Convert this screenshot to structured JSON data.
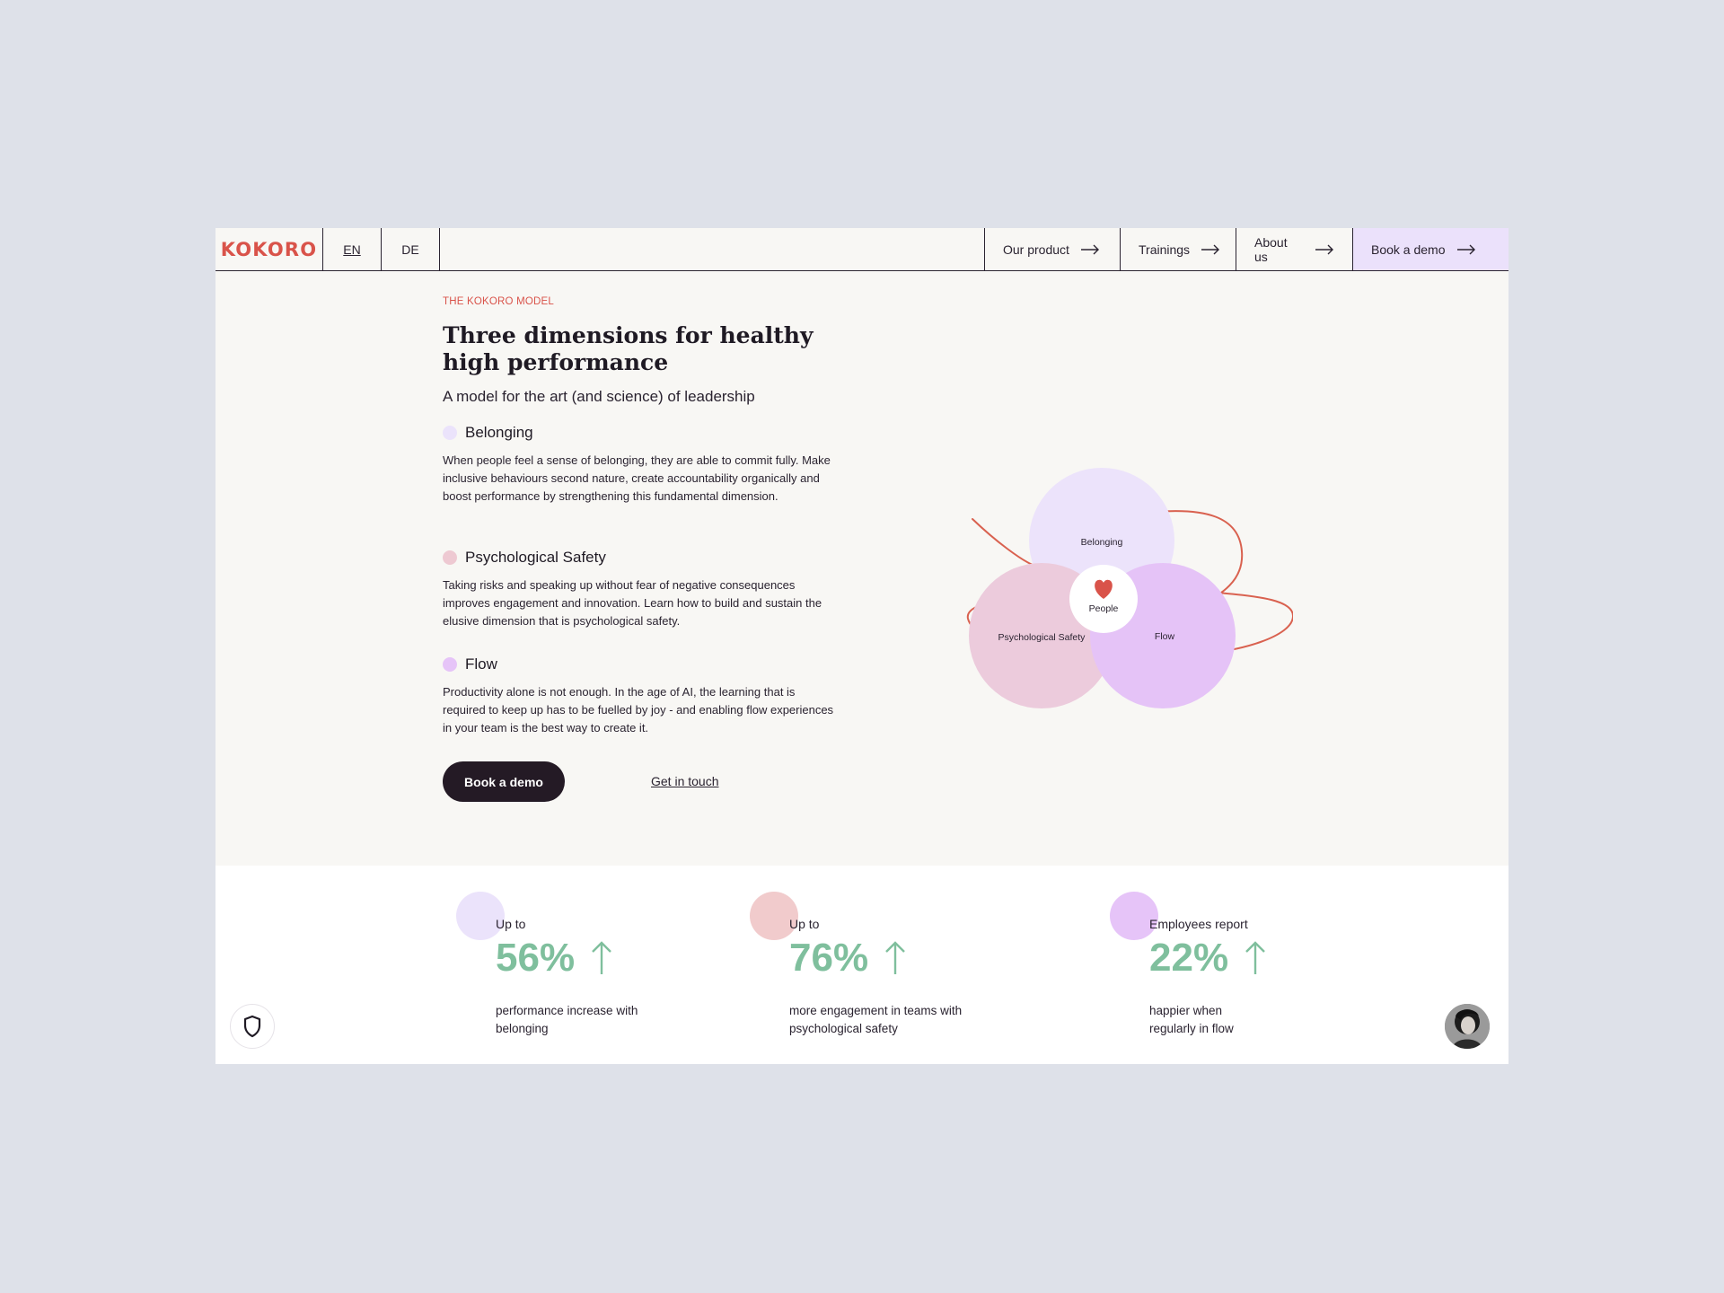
{
  "nav": {
    "logo": "KOKORO",
    "languages": [
      {
        "label": "EN",
        "active": true
      },
      {
        "label": "DE",
        "active": false
      }
    ],
    "links": [
      "Our product",
      "Trainings",
      "About us",
      "Book a demo"
    ]
  },
  "hero": {
    "eyebrow": "THE KOKORO MODEL",
    "title": "Three dimensions for healthy high performance",
    "subtitle": "A model for the art (and science) of leadership",
    "dimensions": [
      {
        "name": "Belonging",
        "color": "#ebe3fb",
        "text": "When people feel a sense of belonging, they are able to commit fully. Make inclusive behaviours second nature, create accountability organically and boost performance by strengthening this fundamental dimension."
      },
      {
        "name": "Psychological Safety",
        "color": "#eec9d2",
        "text": "Taking risks and speaking up without fear of negative consequences improves engagement and innovation. Learn how to build and sustain the elusive dimension that is psychological safety."
      },
      {
        "name": "Flow",
        "color": "#e6c4f8",
        "text": "Productivity alone is not enough. In the age of AI, the learning that is required to keep up has to be fuelled by joy - and enabling flow experiences in your team is the best way to create it."
      }
    ],
    "cta_primary": "Book a demo",
    "cta_secondary": "Get in touch"
  },
  "diagram": {
    "center_label": "People",
    "circles": [
      "Belonging",
      "Psychological Safety",
      "Flow"
    ],
    "accent": "#d9534a"
  },
  "stats": [
    {
      "pre": "Up to",
      "value": "56%",
      "desc": "performance increase with belonging",
      "color": "#ebe3fb"
    },
    {
      "pre": "Up to",
      "value": "76%",
      "desc": "more engagement in teams with psychological safety",
      "color": "#f1cbcc"
    },
    {
      "pre": "Employees report",
      "value": "22%",
      "desc": "happier when regularly in flow",
      "color": "#e6c4f8"
    }
  ],
  "icons": [
    "shield-icon",
    "arrow-right-icon",
    "heart-icon",
    "arrow-up-icon",
    "avatar"
  ]
}
